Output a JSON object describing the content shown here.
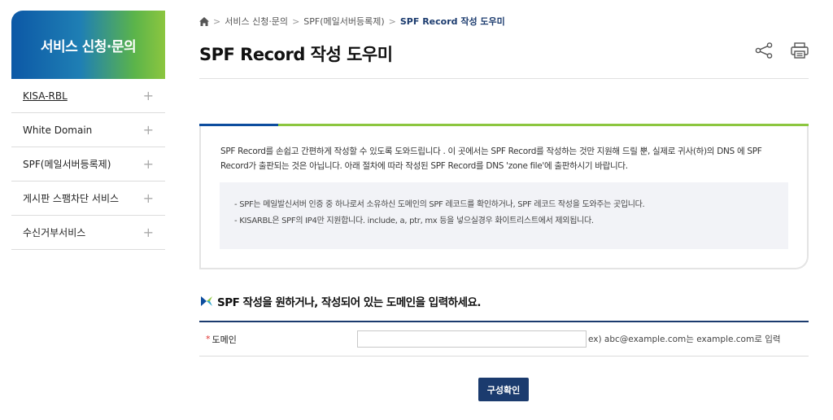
{
  "sidebar": {
    "title": "서비스 신청·문의",
    "items": [
      {
        "label": "KISA-RBL"
      },
      {
        "label": "White Domain"
      },
      {
        "label": "SPF(메일서버등록제)"
      },
      {
        "label": "게시판 스팸차단 서비스"
      },
      {
        "label": "수신거부서비스"
      }
    ],
    "expand_symbol": "+"
  },
  "breadcrumb": {
    "items": [
      "서비스 신청·문의",
      "SPF(메일서버등록제)"
    ],
    "current": "SPF Record 작성 도우미",
    "separator": ">"
  },
  "page": {
    "title": "SPF Record 작성 도우미"
  },
  "info": {
    "intro": "SPF Record를 손쉽고 간편하게 작성할 수 있도록 도와드립니다 . 이 곳에서는 SPF Record를 작성하는 것만 지원해 드릴 뿐, 실제로 귀사(하)의 DNS 에 SPF Record가 출판되는 것은 아닙니다. 아래 절차에 따라 작성된 SPF Record를 DNS 'zone file'에 출판하시기 바랍니다.",
    "notes": [
      "SPF는 메일발신서버 인증 중 하나로서 소유하신 도메인의 SPF 레코드를 확인하거나, SPF 레코드 작성을 도와주는 곳입니다.",
      "KISARBL은 SPF의 IP4만 지원합니다. include, a, ptr, mx 등을 넣으실경우 화이트리스트에서 제외됩니다."
    ]
  },
  "form": {
    "section_title": "SPF 작성을 원하거나, 작성되어 있는 도메인을 입력하세요.",
    "required_mark": "*",
    "domain_label": "도메인",
    "domain_value": "",
    "domain_hint": "ex) abc@example.com는 example.com로 입력",
    "submit_label": "구성확인"
  },
  "colors": {
    "navy": "#1b3b6e",
    "green": "#8cc63f",
    "blue": "#0d4d9e",
    "required": "#e0312f"
  }
}
